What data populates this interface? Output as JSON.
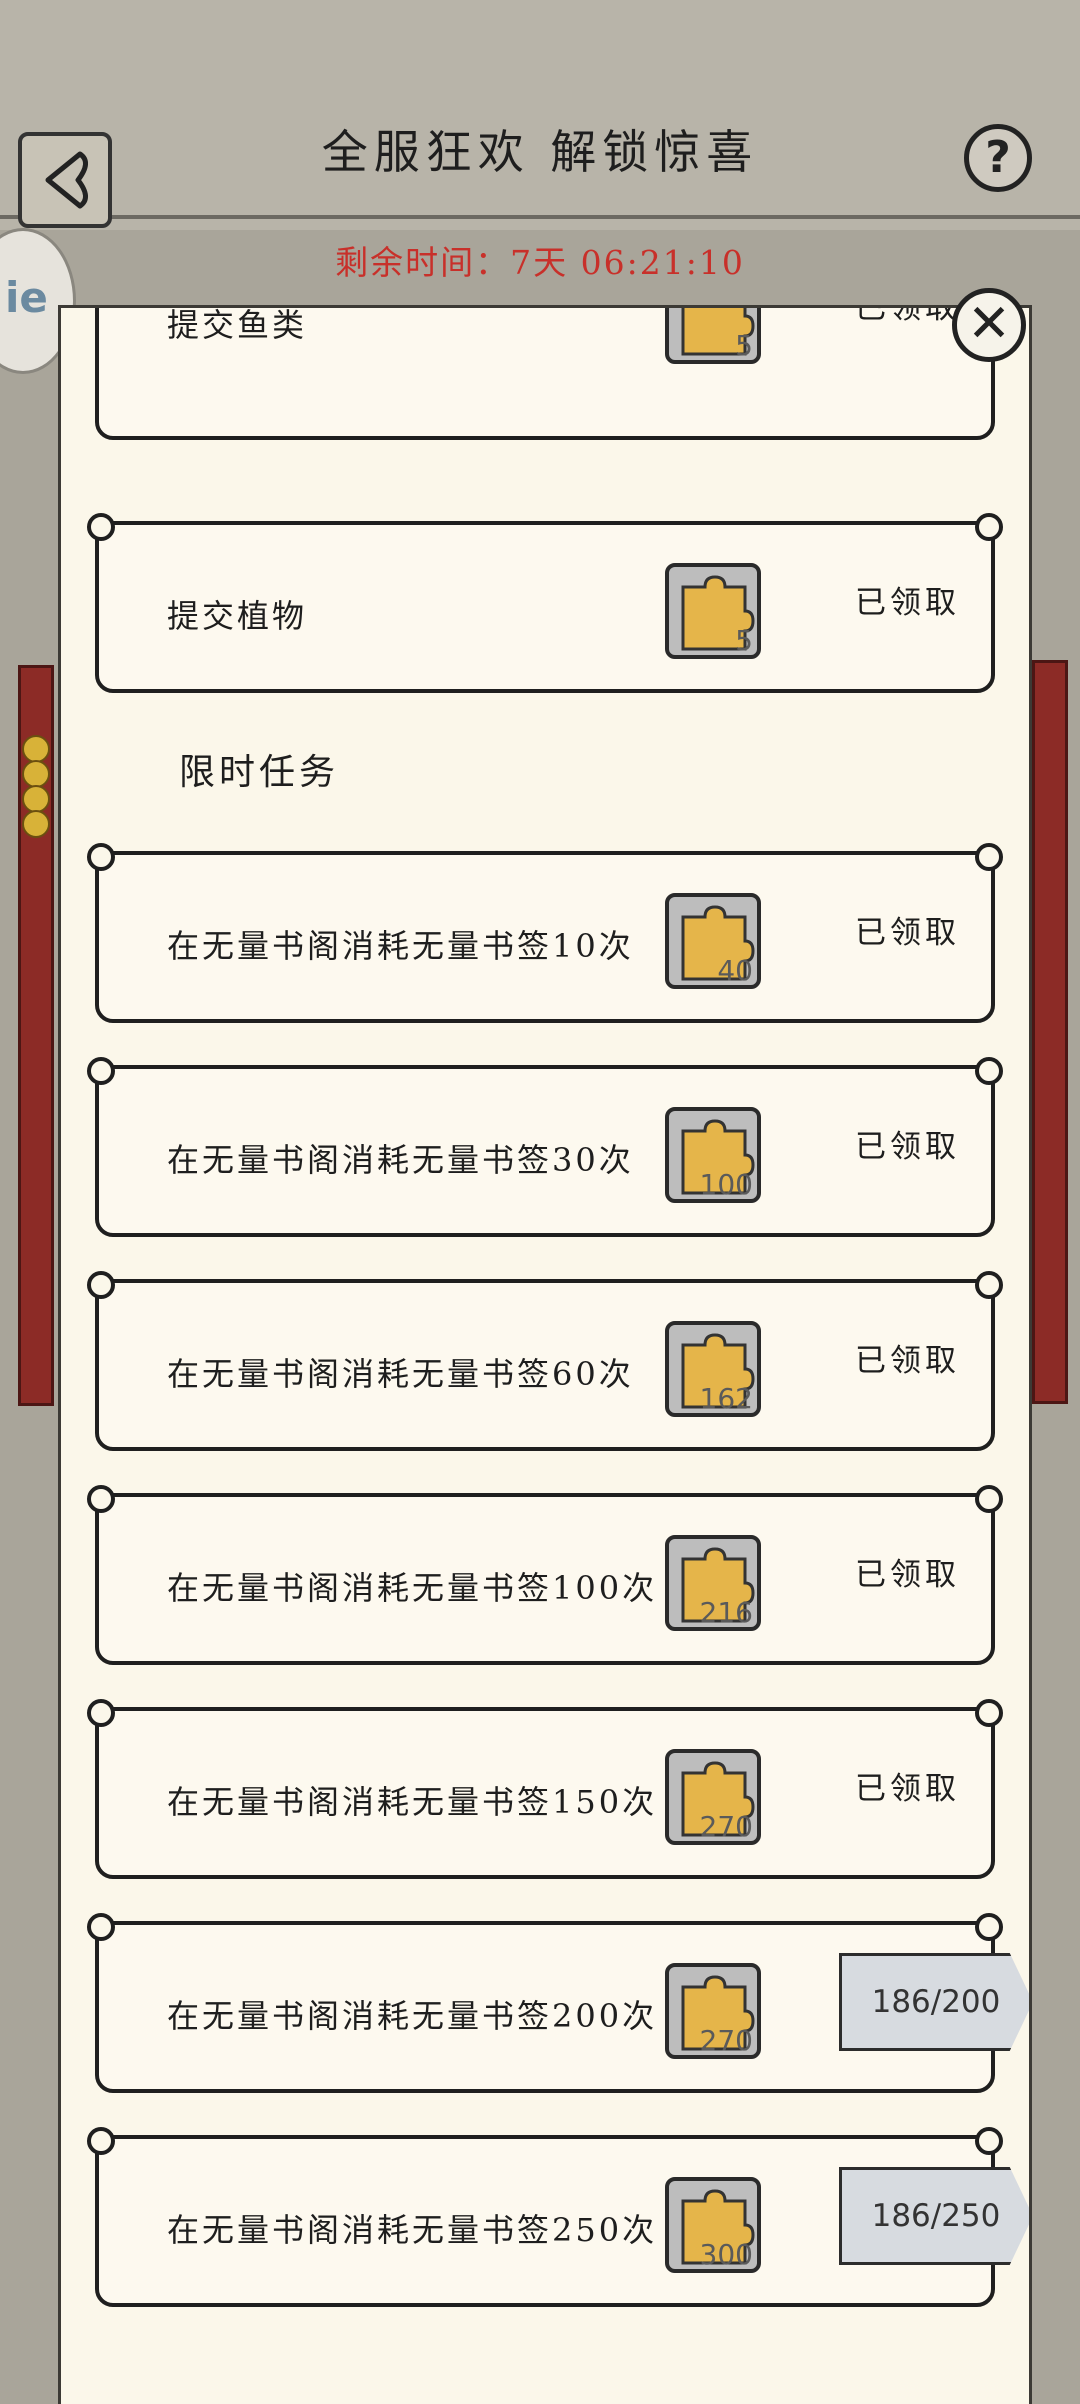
{
  "header": {
    "title": "全服狂欢  解锁惊喜",
    "timer_label": "剩余时间：",
    "timer_value": "7天  06:21:10",
    "help_label": "?",
    "side_badge": "ie"
  },
  "panel": {
    "close_label": "✕",
    "section_title": "限时任务",
    "top_tasks": [
      {
        "name": "提交鱼类",
        "reward": "5",
        "status": "已领取"
      },
      {
        "name": "提交植物",
        "reward": "5",
        "status": "已领取"
      }
    ],
    "timed_tasks": [
      {
        "name": "在无量书阁消耗无量书签10次",
        "reward": "40",
        "status": "已领取"
      },
      {
        "name": "在无量书阁消耗无量书签30次",
        "reward": "100",
        "status": "已领取"
      },
      {
        "name": "在无量书阁消耗无量书签60次",
        "reward": "162",
        "status": "已领取"
      },
      {
        "name": "在无量书阁消耗无量书签100次",
        "reward": "216",
        "status": "已领取"
      },
      {
        "name": "在无量书阁消耗无量书签150次",
        "reward": "270",
        "status": "已领取"
      },
      {
        "name": "在无量书阁消耗无量书签200次",
        "reward": "270",
        "progress": "186/200"
      },
      {
        "name": "在无量书阁消耗无量书签250次",
        "reward": "300",
        "progress": "186/250"
      }
    ]
  },
  "icons": {
    "back": "back-arrow-icon",
    "help": "question-mark-icon",
    "close": "close-icon",
    "reward": "puzzle-piece-icon"
  },
  "colors": {
    "timer": "#c8302a",
    "puzzle": "#e5b54a",
    "rail": "#8c2b26"
  }
}
